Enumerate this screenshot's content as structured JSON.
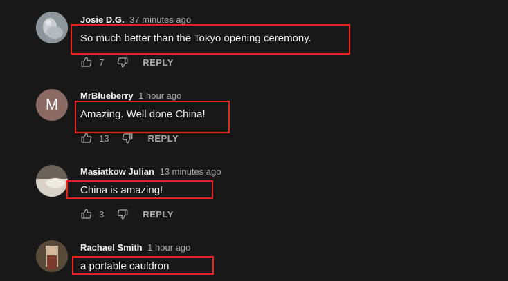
{
  "comments": [
    {
      "author": "Josie D.G.",
      "time": "37 minutes ago",
      "text": "So much better than the Tokyo opening ceremony.",
      "likes": "7",
      "reply_label": "REPLY"
    },
    {
      "author": "MrBlueberry",
      "time": "1 hour ago",
      "text": "Amazing. Well done China!",
      "likes": "13",
      "reply_label": "REPLY",
      "avatar_letter": "M"
    },
    {
      "author": "Masiatkow Julian",
      "time": "13 minutes ago",
      "text": "China is amazing!",
      "likes": "3",
      "reply_label": "REPLY"
    },
    {
      "author": "Rachael Smith",
      "time": "1 hour ago",
      "text": "a portable cauldron"
    }
  ],
  "colors": {
    "background": "#181818",
    "highlight": "#e5231d",
    "avatar_m": "#8a6a62"
  },
  "icons": [
    "thumbs-up-icon",
    "thumbs-down-icon"
  ]
}
